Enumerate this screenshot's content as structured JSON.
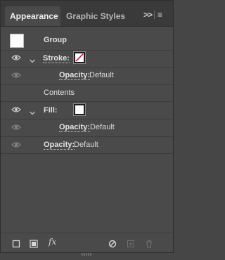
{
  "tabs": {
    "active": "Appearance",
    "inactive": "Graphic Styles",
    "collapse_glyph": ">>",
    "menu_glyph": "≡"
  },
  "rows": {
    "group": {
      "label": "Group"
    },
    "stroke": {
      "label": "Stroke:",
      "swatch_fill": "#ffffff",
      "slash_color": "#c2185b"
    },
    "stroke_opacity": {
      "label": "Opacity:",
      "value": "Default"
    },
    "contents": {
      "label": "Contents"
    },
    "fill": {
      "label": "Fill:",
      "swatch_fill": "#ffffff"
    },
    "fill_opacity": {
      "label": "Opacity:",
      "value": "Default"
    },
    "group_opacity": {
      "label": "Opacity:",
      "value": "Default"
    }
  },
  "footer": {
    "fx_label": "fx"
  },
  "colors": {
    "panel_bg": "#4a4a4a",
    "header_bg": "#3a3a3a",
    "text": "#e2e2e2",
    "stroke_none_slash": "#c2185b"
  }
}
